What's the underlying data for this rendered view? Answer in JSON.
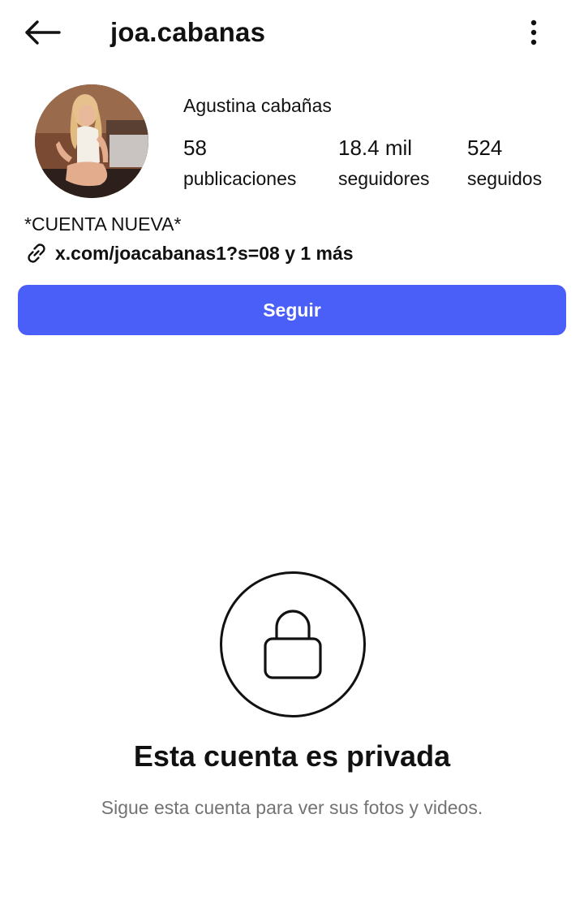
{
  "header": {
    "back_icon": "arrow-left-icon",
    "username": "joa.cabanas",
    "more_icon": "more-vertical-icon"
  },
  "profile": {
    "avatar_icon": "profile-photo",
    "full_name": "Agustina cabañas",
    "stats": [
      {
        "value": "58",
        "label": "publicaciones"
      },
      {
        "value": "18.4 mil",
        "label": "seguidores"
      },
      {
        "value": "524",
        "label": "seguidos"
      }
    ],
    "bio": "*CUENTA NUEVA*",
    "link_icon": "link-icon",
    "link_text": "x.com/joacabanas1?s=08 y 1 más"
  },
  "actions": {
    "follow_label": "Seguir",
    "follow_color": "#4a5ff7"
  },
  "private": {
    "lock_icon": "lock-icon",
    "title": "Esta cuenta es privada",
    "subtitle": "Sigue esta cuenta para ver sus fotos y videos."
  }
}
